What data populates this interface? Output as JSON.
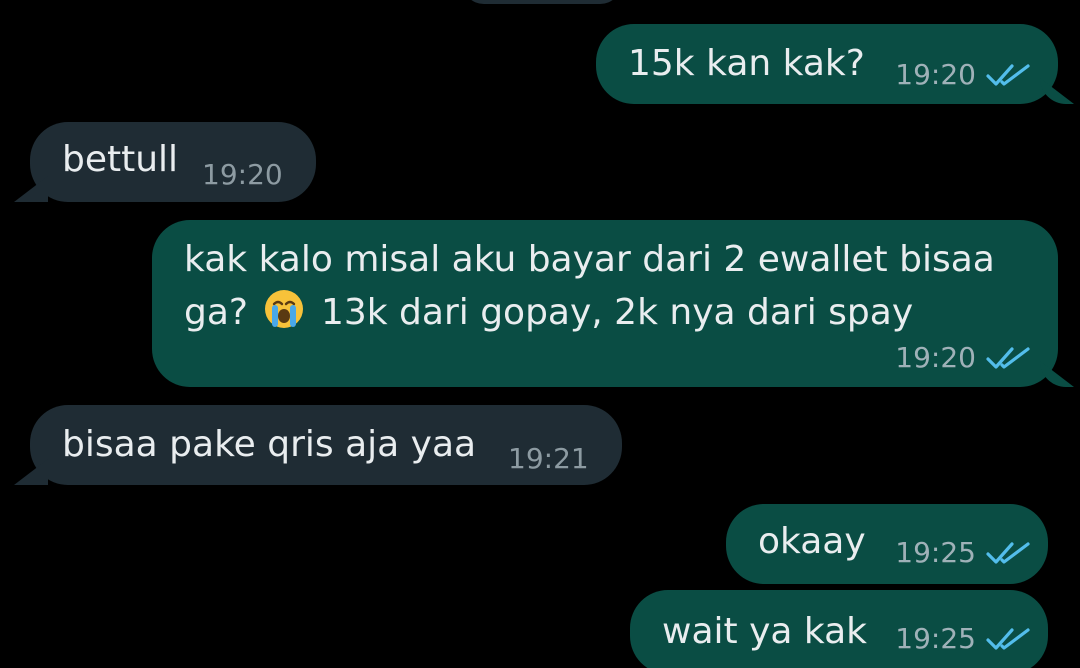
{
  "messages": [
    {
      "id": "m1",
      "direction": "outgoing",
      "text": "15k kan kak?",
      "time": "19:20",
      "status": "read"
    },
    {
      "id": "m2",
      "direction": "incoming",
      "text": "bettull",
      "time": "19:20"
    },
    {
      "id": "m3",
      "direction": "outgoing",
      "line1": "kak kalo misal aku bayar dari 2 ewallet bisaa",
      "line2_before": "ga?",
      "emoji": "loudly-crying-face-emoji",
      "line2_after": "13k dari gopay, 2k nya dari spay",
      "time": "19:20",
      "status": "read"
    },
    {
      "id": "m4",
      "direction": "incoming",
      "text": "bisaa pake qris aja yaa",
      "time": "19:21"
    },
    {
      "id": "m5",
      "direction": "outgoing",
      "text": "okaay",
      "time": "19:25",
      "status": "read"
    },
    {
      "id": "m6",
      "direction": "outgoing",
      "text": "wait ya kak",
      "time": "19:25",
      "status": "read"
    }
  ],
  "colors": {
    "background": "#000000",
    "outgoing_bubble": "#0a4d44",
    "incoming_bubble": "#1f2c34",
    "read_ticks": "#53bdeb",
    "timestamp": "#9fb1b8"
  },
  "icons": {
    "read_receipt": "double-check-icon"
  }
}
